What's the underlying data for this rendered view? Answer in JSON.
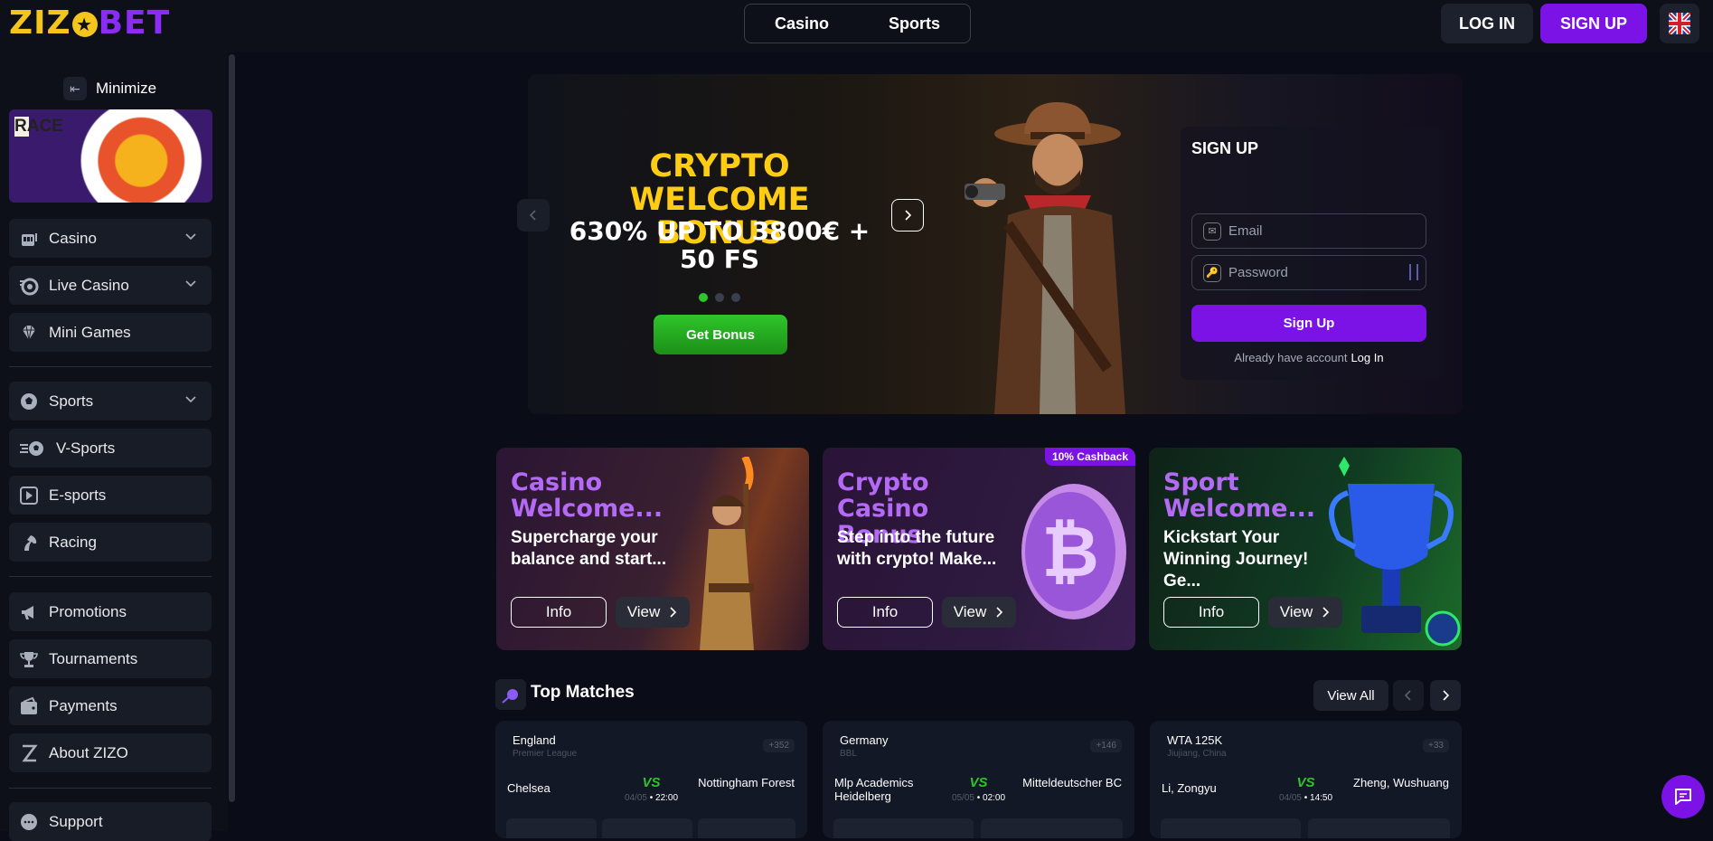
{
  "header": {
    "logo_left": "ZIZ",
    "logo_mid": "O",
    "logo_right": "BET",
    "switcher": [
      "Casino",
      "Sports"
    ],
    "login": "LOG IN",
    "signup": "SIGN UP",
    "language": "English (UK flag)"
  },
  "sidebar": {
    "minimize": "Minimize",
    "race_banner": "RACE",
    "group1": [
      {
        "label": "Casino",
        "icon": "slot-machine-icon",
        "expandable": true
      },
      {
        "label": "Live Casino",
        "icon": "roulette-icon",
        "expandable": true
      },
      {
        "label": "Mini Games",
        "icon": "diamond-icon",
        "expandable": false
      }
    ],
    "group2": [
      {
        "label": "Sports",
        "icon": "soccer-ball-icon",
        "expandable": true
      },
      {
        "label": "V-Sports",
        "icon": "virtual-sports-icon",
        "expandable": false
      },
      {
        "label": "E-sports",
        "icon": "play-icon",
        "expandable": false
      },
      {
        "label": "Racing",
        "icon": "horse-icon",
        "expandable": false
      }
    ],
    "group3": [
      {
        "label": "Promotions",
        "icon": "megaphone-icon"
      },
      {
        "label": "Tournaments",
        "icon": "trophy-icon"
      },
      {
        "label": "Payments",
        "icon": "wallet-icon"
      },
      {
        "label": "About ZIZO",
        "icon": "zizo-icon"
      }
    ],
    "support": "Support"
  },
  "hero": {
    "title_line1": "CRYPTO",
    "title_line2": "WELCOME BONUS",
    "subtitle_line1": "630% UP TO 3800€ +",
    "subtitle_line2": "50 FS",
    "cta": "Get Bonus",
    "slides": 3,
    "active_slide": 1
  },
  "signup_form": {
    "title": "SIGN UP",
    "email_placeholder": "Email",
    "password_placeholder": "Password",
    "submit": "Sign Up",
    "already": "Already have account",
    "login_link": "Log In"
  },
  "promos": [
    {
      "title": "Casino Welcome...",
      "desc": "Supercharge your balance and start...",
      "info": "Info",
      "view": "View",
      "badge": ""
    },
    {
      "title": "Crypto Casino Bonus",
      "desc": "Step into the future with crypto! Make...",
      "info": "Info",
      "view": "View",
      "badge": "10% Cashback"
    },
    {
      "title": "Sport Welcome...",
      "desc": "Kickstart Your Winning Journey! Ge...",
      "info": "Info",
      "view": "View",
      "badge": ""
    }
  ],
  "top_matches": {
    "title": "Top Matches",
    "view_all": "View All",
    "matches": [
      {
        "league": "England",
        "sub": "Premier League",
        "count": "+352",
        "team1": "Chelsea",
        "team2": "Nottingham Forest",
        "vs": "VS",
        "date": "04/05",
        "time": "22:00"
      },
      {
        "league": "Germany",
        "sub": "BBL",
        "count": "+146",
        "team1": "Mlp Academics Heidelberg",
        "team2": "Mitteldeutscher BC",
        "vs": "VS",
        "date": "05/05",
        "time": "02:00"
      },
      {
        "league": "WTA 125K",
        "sub": "Jiujiang, China",
        "count": "+33",
        "team1": "Li, Zongyu",
        "team2": "Zheng, Wushuang",
        "vs": "VS",
        "date": "04/05",
        "time": "14:50"
      }
    ]
  },
  "colors": {
    "accent_purple": "#7b12e6",
    "logo_yellow": "#f4c51c",
    "green": "#2ec52b",
    "bg": "#0a0d17"
  }
}
